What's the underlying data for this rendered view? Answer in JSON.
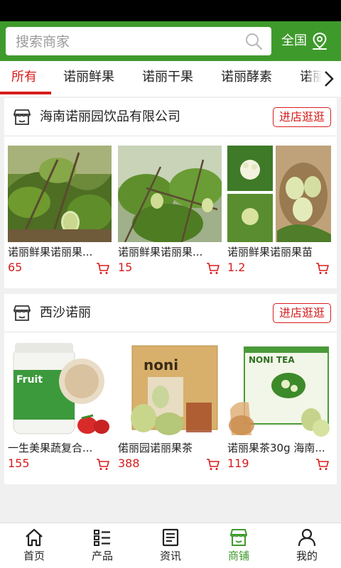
{
  "search": {
    "placeholder": "搜索商家"
  },
  "region": {
    "label": "全国"
  },
  "tabs": [
    {
      "label": "所有",
      "active": true
    },
    {
      "label": "诺丽鲜果",
      "active": false
    },
    {
      "label": "诺丽干果",
      "active": false
    },
    {
      "label": "诺丽酵素",
      "active": false
    },
    {
      "label": "诺丽",
      "active": false
    }
  ],
  "shops": [
    {
      "name": "海南诺丽园饮品有限公司",
      "visit_label": "进店逛逛",
      "products": [
        {
          "name": "诺丽鲜果诺丽果...",
          "price": "65"
        },
        {
          "name": "诺丽鲜果诺丽果...",
          "price": "15"
        },
        {
          "name": "诺丽鲜果诺丽果苗",
          "price": "1.2"
        }
      ]
    },
    {
      "name": "西沙诺丽",
      "visit_label": "进店逛逛",
      "products": [
        {
          "name": "一生美果蔬复合...",
          "price": "155",
          "image_text": "Fruit"
        },
        {
          "name": "偌丽园诺丽果茶",
          "price": "388",
          "image_text": "noni"
        },
        {
          "name": "诺丽果茶30g 海南...",
          "price": "119",
          "image_text": "NONI TEA"
        }
      ]
    }
  ],
  "bottom_nav": [
    {
      "label": "首页",
      "icon": "home-icon",
      "active": false
    },
    {
      "label": "产品",
      "icon": "list-icon",
      "active": false
    },
    {
      "label": "资讯",
      "icon": "news-icon",
      "active": false
    },
    {
      "label": "商铺",
      "icon": "shop-icon",
      "active": true
    },
    {
      "label": "我的",
      "icon": "user-icon",
      "active": false
    }
  ],
  "colors": {
    "brand": "#3f9a2c",
    "accent": "#d71c1c",
    "text": "#222222",
    "background": "#f0f0f0"
  }
}
